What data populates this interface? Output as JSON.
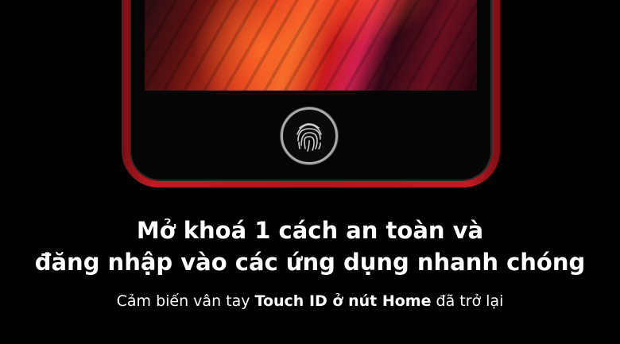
{
  "headline": {
    "line1": "Mở khoá 1 cách an toàn và",
    "line2": "đăng nhập vào các ứng dụng nhanh chóng"
  },
  "subtitle": {
    "part1": "Cảm biến vân tay ",
    "bold": "Touch ID ở nút Home",
    "part2": " đã trở lại"
  },
  "colors": {
    "background": "#000000",
    "phone_frame": "#b3161e",
    "text": "#ffffff"
  },
  "icons": {
    "home_button": "fingerprint-icon"
  }
}
